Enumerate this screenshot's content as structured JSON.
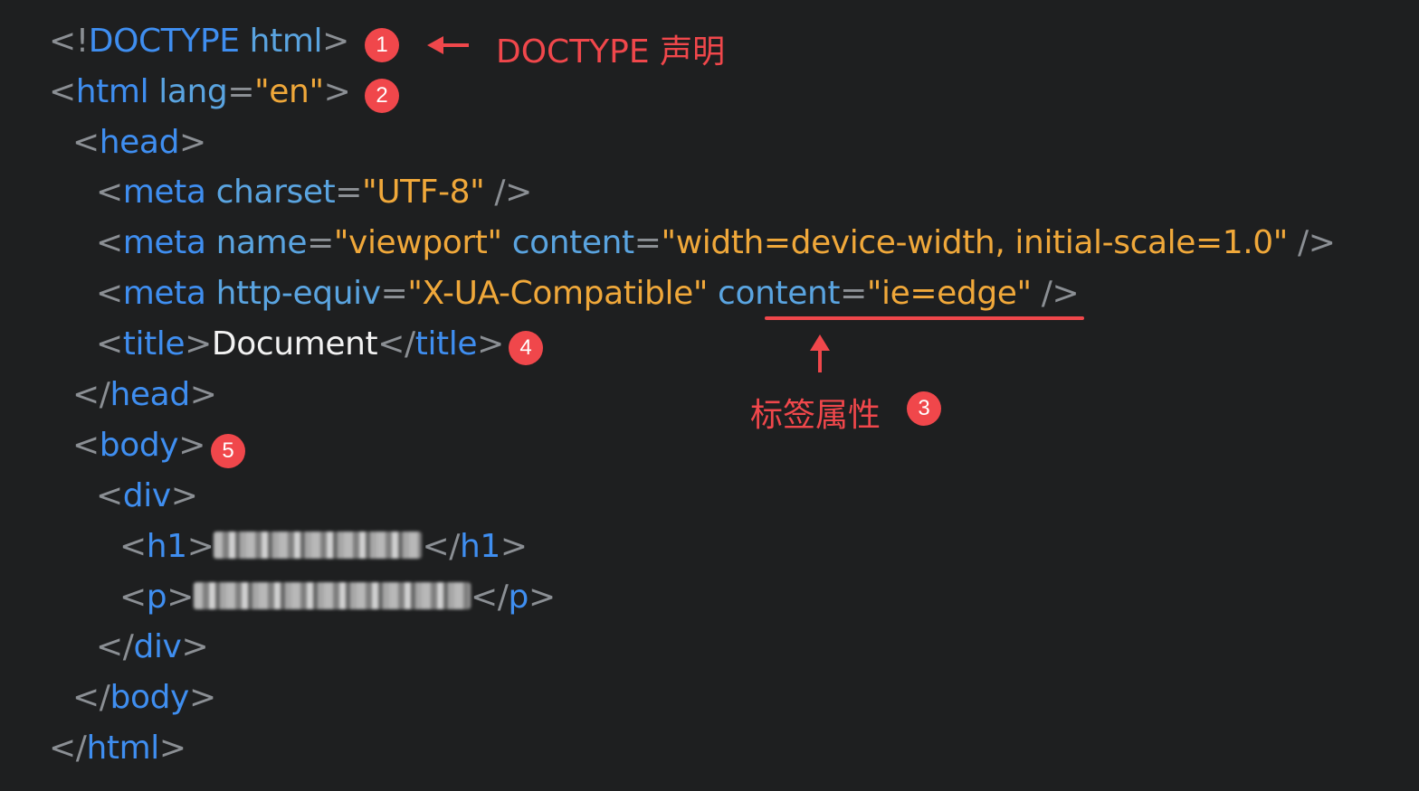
{
  "code": {
    "lines": [
      {
        "tokens": [
          [
            "p",
            "<!"
          ],
          [
            "t",
            "DOCTYPE"
          ],
          [
            "a",
            " html"
          ],
          [
            "p",
            ">"
          ]
        ]
      },
      {
        "tokens": [
          [
            "p",
            "<"
          ],
          [
            "t",
            "html"
          ],
          [
            "a",
            " lang"
          ],
          [
            "p",
            "="
          ],
          [
            "s",
            "\"en\""
          ],
          [
            "p",
            ">"
          ]
        ]
      },
      {
        "tokens": [
          [
            "p",
            "<"
          ],
          [
            "t",
            "head"
          ],
          [
            "p",
            ">"
          ]
        ]
      },
      {
        "tokens": [
          [
            "p",
            "<"
          ],
          [
            "t",
            "meta"
          ],
          [
            "a",
            " charset"
          ],
          [
            "p",
            "="
          ],
          [
            "s",
            "\"UTF-8\""
          ],
          [
            "p",
            " />"
          ]
        ]
      },
      {
        "tokens": [
          [
            "p",
            "<"
          ],
          [
            "t",
            "meta"
          ],
          [
            "a",
            " name"
          ],
          [
            "p",
            "="
          ],
          [
            "s",
            "\"viewport\""
          ],
          [
            "a",
            " content"
          ],
          [
            "p",
            "="
          ],
          [
            "s",
            "\"width=device-width, initial-scale=1.0\""
          ],
          [
            "p",
            " />"
          ]
        ]
      },
      {
        "tokens": [
          [
            "p",
            "<"
          ],
          [
            "t",
            "meta"
          ],
          [
            "a",
            " http-equiv"
          ],
          [
            "p",
            "="
          ],
          [
            "s",
            "\"X-UA-Compatible\""
          ],
          [
            "a",
            " content"
          ],
          [
            "p",
            "="
          ],
          [
            "s",
            "\"ie=edge\""
          ],
          [
            "p",
            " />"
          ]
        ]
      },
      {
        "tokens": [
          [
            "p",
            "<"
          ],
          [
            "t",
            "title"
          ],
          [
            "p",
            ">"
          ],
          [
            "txt",
            "Document"
          ],
          [
            "p",
            "</"
          ],
          [
            "t",
            "title"
          ],
          [
            "p",
            ">"
          ]
        ]
      },
      {
        "tokens": [
          [
            "p",
            "</"
          ],
          [
            "t",
            "head"
          ],
          [
            "p",
            ">"
          ]
        ]
      },
      {
        "tokens": [
          [
            "p",
            "<"
          ],
          [
            "t",
            "body"
          ],
          [
            "p",
            ">"
          ]
        ]
      },
      {
        "tokens": [
          [
            "p",
            "<"
          ],
          [
            "t",
            "div"
          ],
          [
            "p",
            ">"
          ]
        ]
      },
      {
        "tokens": [
          [
            "p",
            "<"
          ],
          [
            "t",
            "h1"
          ],
          [
            "p",
            ">"
          ],
          [
            "blur",
            "230"
          ],
          [
            "p",
            "</"
          ],
          [
            "t",
            "h1"
          ],
          [
            "p",
            ">"
          ]
        ]
      },
      {
        "tokens": [
          [
            "p",
            "<"
          ],
          [
            "t",
            "p"
          ],
          [
            "p",
            ">"
          ],
          [
            "blur",
            "306"
          ],
          [
            "p",
            "</"
          ],
          [
            "t",
            "p"
          ],
          [
            "p",
            ">"
          ]
        ]
      },
      {
        "tokens": [
          [
            "p",
            "</"
          ],
          [
            "t",
            "div"
          ],
          [
            "p",
            ">"
          ]
        ]
      },
      {
        "tokens": [
          [
            "p",
            "</"
          ],
          [
            "t",
            "body"
          ],
          [
            "p",
            ">"
          ]
        ]
      },
      {
        "tokens": [
          [
            "p",
            "</"
          ],
          [
            "t",
            "html"
          ],
          [
            "p",
            ">"
          ]
        ]
      }
    ]
  },
  "annotations": {
    "badge_1": "1",
    "badge_2": "2",
    "badge_3": "3",
    "badge_4": "4",
    "badge_5": "5",
    "doctype_label": "DOCTYPE 声明",
    "attr_label": "标签属性"
  },
  "colors": {
    "background": "#1e1f20",
    "tag": "#3f8ef0",
    "attribute": "#5aa4e0",
    "string": "#f0a83a",
    "punctuation": "#8b8f94",
    "annotation": "#f0474b"
  }
}
